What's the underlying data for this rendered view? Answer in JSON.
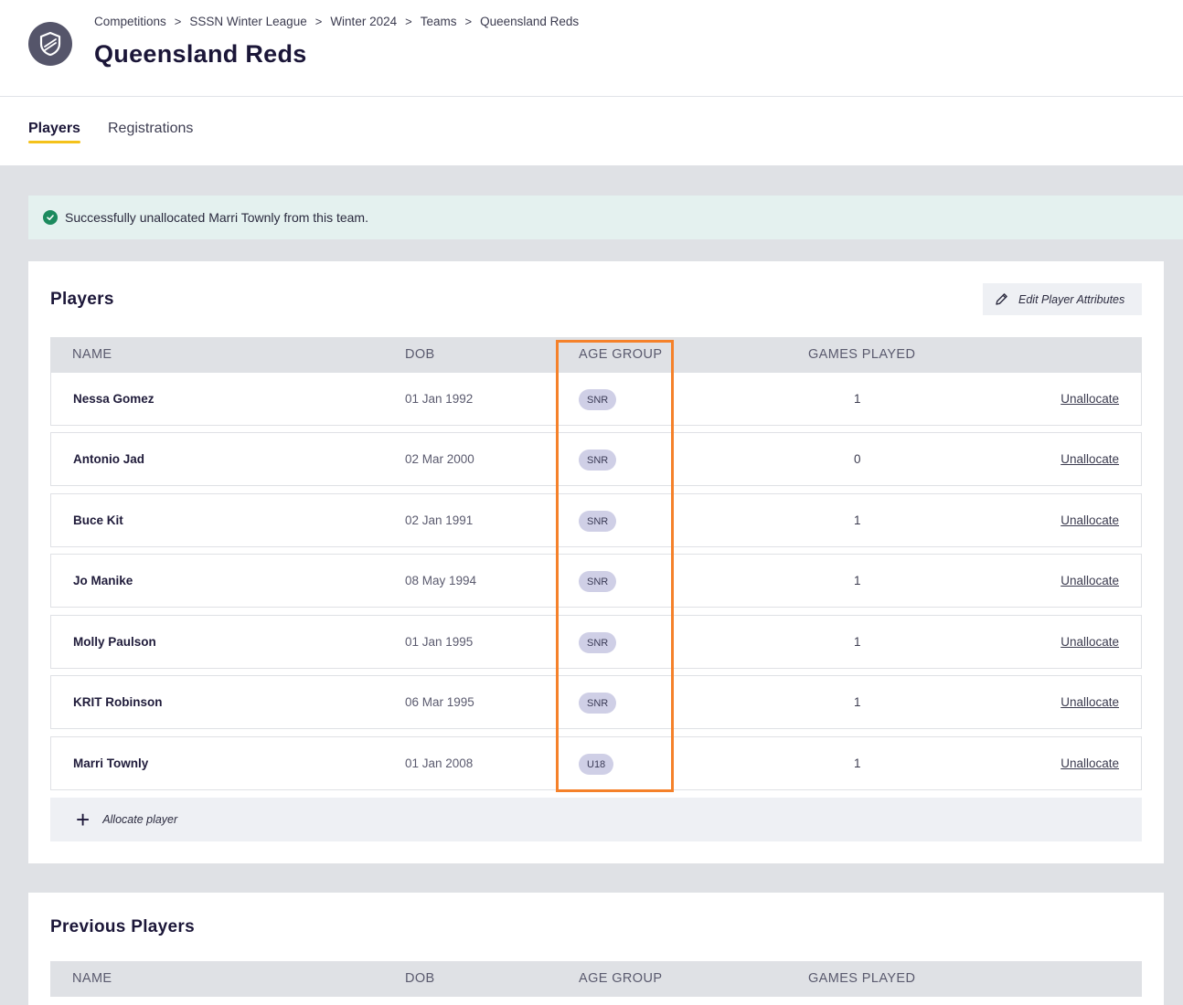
{
  "breadcrumb": [
    "Competitions",
    "SSSN Winter League",
    "Winter 2024",
    "Teams",
    "Queensland Reds"
  ],
  "breadcrumb_separator": ">",
  "page_title": "Queensland Reds",
  "tabs": [
    {
      "label": "Players",
      "active": true
    },
    {
      "label": "Registrations",
      "active": false
    }
  ],
  "alert": {
    "message": "Successfully unallocated Marri Townly from this team.",
    "icon": "check-circle-icon",
    "color": "#1c8a5e"
  },
  "players": {
    "title": "Players",
    "edit_button": "Edit Player Attributes",
    "columns": {
      "name": "NAME",
      "dob": "DOB",
      "age_group": "AGE GROUP",
      "games_played": "GAMES PLAYED"
    },
    "rows": [
      {
        "name": "Nessa Gomez",
        "dob": "01 Jan 1992",
        "age_group": "SNR",
        "games": "1",
        "action": "Unallocate"
      },
      {
        "name": "Antonio Jad",
        "dob": "02 Mar 2000",
        "age_group": "SNR",
        "games": "0",
        "action": "Unallocate"
      },
      {
        "name": "Buce Kit",
        "dob": "02 Jan 1991",
        "age_group": "SNR",
        "games": "1",
        "action": "Unallocate"
      },
      {
        "name": "Jo Manike",
        "dob": "08 May 1994",
        "age_group": "SNR",
        "games": "1",
        "action": "Unallocate"
      },
      {
        "name": "Molly Paulson",
        "dob": "01 Jan 1995",
        "age_group": "SNR",
        "games": "1",
        "action": "Unallocate"
      },
      {
        "name": "KRIT Robinson",
        "dob": "06 Mar 1995",
        "age_group": "SNR",
        "games": "1",
        "action": "Unallocate"
      },
      {
        "name": "Marri Townly",
        "dob": "01 Jan 2008",
        "age_group": "U18",
        "games": "1",
        "action": "Unallocate"
      }
    ],
    "allocate_label": "Allocate player"
  },
  "previous_players": {
    "title": "Previous Players",
    "columns": {
      "name": "NAME",
      "dob": "DOB",
      "age_group": "AGE GROUP",
      "games_played": "GAMES PLAYED"
    }
  },
  "colors": {
    "accent_tab": "#f4c21b",
    "highlight": "#f5812a",
    "badge": "#cfcfe6"
  }
}
